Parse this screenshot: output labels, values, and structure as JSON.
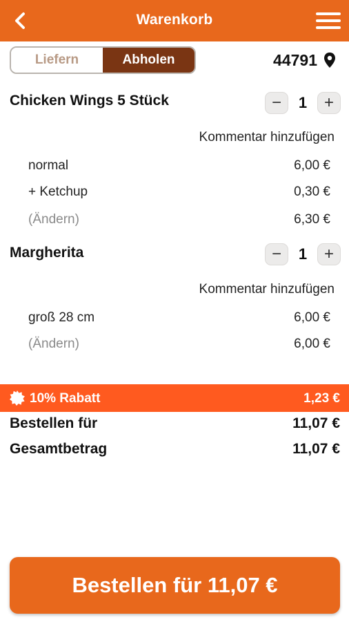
{
  "header": {
    "title": "Warenkorb"
  },
  "delivery_toggle": {
    "options": [
      "Liefern",
      "Abholen"
    ],
    "selected": "Abholen"
  },
  "location": {
    "zip": "44791"
  },
  "items": [
    {
      "name": "Chicken Wings 5 Stück",
      "quantity": "1",
      "comment_label": "Kommentar hinzufügen",
      "lines": [
        {
          "label": "normal",
          "price": "6,00 €"
        },
        {
          "label": "+ Ketchup",
          "price": "0,30 €"
        },
        {
          "label": "(Ändern)",
          "price": "6,30 €"
        }
      ]
    },
    {
      "name": "Margherita",
      "quantity": "1",
      "comment_label": "Kommentar hinzufügen",
      "lines": [
        {
          "label": "groß 28 cm",
          "price": "6,00 €"
        },
        {
          "label": "(Ändern)",
          "price": "6,00 €"
        }
      ]
    }
  ],
  "discount": {
    "label": "10% Rabatt",
    "value": "1,23 €"
  },
  "totals": {
    "order_label": "Bestellen für",
    "order_value": "11,07 €",
    "grand_label": "Gesamtbetrag",
    "grand_value": "11,07 €"
  },
  "order_button": {
    "label": "Bestellen für 11,07 €"
  },
  "colors": {
    "brand": "#e8681c",
    "active_toggle": "#7a3513",
    "discount_bar": "#ff5a1f"
  }
}
